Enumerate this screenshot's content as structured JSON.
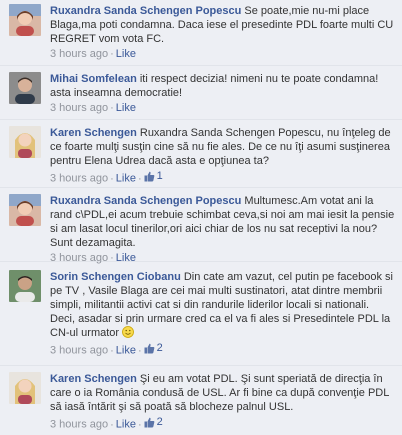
{
  "comments": [
    {
      "author": "Ruxandra Sanda Schengen Popescu",
      "text": "Se poate,mie nu-mi place Blaga,ma poti condamna. Daca iese el presedinte PDL foarte multi CU REGRET vom vota FC.",
      "time": "3 hours ago",
      "like": "Like",
      "likes": "",
      "avatar": "woman-avatar"
    },
    {
      "author": "Mihai Somfelean",
      "text": "iti respect decizia! nimeni nu te poate condamna! asta inseamna democratie!",
      "time": "3 hours ago",
      "like": "Like",
      "likes": "",
      "avatar": "man-avatar"
    },
    {
      "author": "Karen Schengen",
      "text": "Ruxandra Sanda Schengen Popescu, nu înţeleg de ce foarte mulţi susţin cine să nu fie ales. De ce nu îţi asumi susţinerea pentru Elena Udrea dacă asta e opţiunea ta?",
      "time": "3 hours ago",
      "like": "Like",
      "likes": "1",
      "avatar": "blonde-woman-avatar"
    },
    {
      "author": "Ruxandra Sanda Schengen Popescu",
      "text": "Multumesc.Am votat ani la rand c\\PDL,ei acum trebuie schimbat ceva,si noi am mai iesit la pensie si am lasat locul tinerilor,ori aici chiar de los nu sat receptivi la nou?Sunt dezamagita.",
      "time": "3 hours ago",
      "like": "Like",
      "likes": "",
      "avatar": "woman-avatar"
    },
    {
      "author": "Sorin Schengen Ciobanu",
      "text": "Din cate am vazut, cel putin pe facebook si pe TV , Vasile Blaga are cei mai multi sustinatori, atat dintre membrii simpli, militantii activi cat si din randurile liderilor locali si nationali. Deci, asadar si prin urmare cred ca el va fi ales si Presedintele PDL la CN-ul urmator",
      "time": "3 hours ago",
      "like": "Like",
      "likes": "2",
      "avatar": "man-avatar-2"
    },
    {
      "author": "Karen Schengen",
      "text": "Şi eu am votat PDL. Şi sunt speriată de direcţia în care o ia România condusă de USL. Ar fi bine ca după convenţie PDL să iasă întărit şi să poată să blocheze palnul USL.",
      "time": "3 hours ago",
      "like": "Like",
      "likes": "2",
      "avatar": "blonde-woman-avatar"
    }
  ],
  "colors": {
    "background": "#edeff4",
    "link": "#3b5998",
    "text": "#333333",
    "meta": "#90949c"
  }
}
